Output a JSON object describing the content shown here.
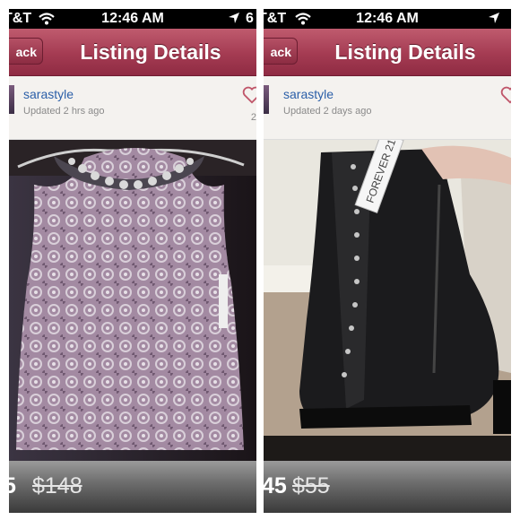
{
  "panels": [
    {
      "status": {
        "carrier": "T&T",
        "time": "12:46 AM",
        "clipped": "6"
      },
      "nav": {
        "back_label": "ack",
        "title": "Listing Details"
      },
      "user": {
        "name": "sarastyle",
        "updated": "Updated 2 hrs ago",
        "like_count": "2"
      },
      "photo_icon": "sleeveless-jeweled-top-photo",
      "price": {
        "current": "5",
        "original": "$148"
      }
    },
    {
      "status": {
        "carrier": "T&T",
        "time": "12:46 AM",
        "clipped": ""
      },
      "nav": {
        "back_label": "ack",
        "title": "Listing Details"
      },
      "user": {
        "name": "sarastyle",
        "updated": "Updated 2 days ago",
        "like_count": ""
      },
      "photo_icon": "black-lace-up-boot-photo",
      "tag_text": "FOREVER 21",
      "price": {
        "current": "45",
        "original": "$55"
      }
    }
  ],
  "colors": {
    "navbar": "#a43b52",
    "username": "#2b5fa8",
    "heart": "#c0566a"
  }
}
